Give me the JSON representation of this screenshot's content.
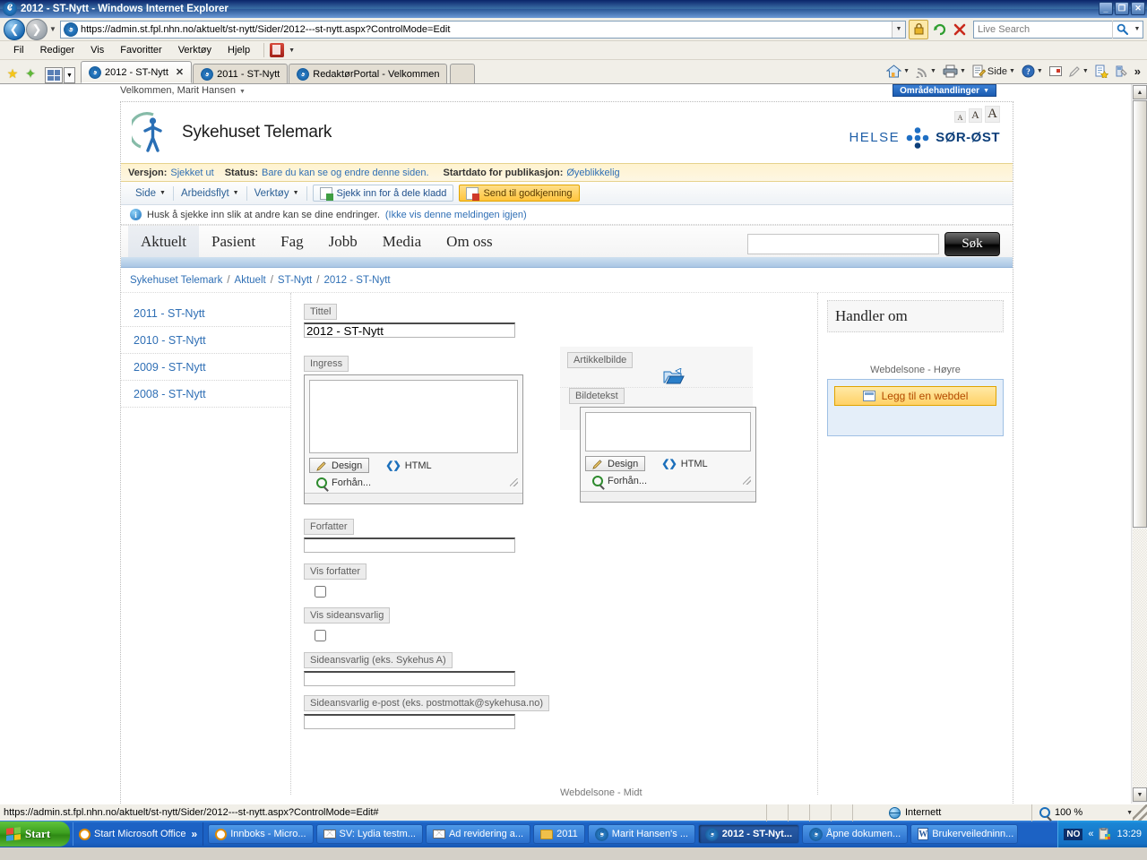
{
  "window": {
    "title": "2012 - ST-Nytt - Windows Internet Explorer",
    "minimize": "_",
    "restore": "❐",
    "close": "✕"
  },
  "browser": {
    "url": "https://admin.st.fpl.nhn.no/aktuelt/st-nytt/Sider/2012---st-nytt.aspx?ControlMode=Edit",
    "search_placeholder": "Live Search",
    "menu": [
      "Fil",
      "Rediger",
      "Vis",
      "Favoritter",
      "Verktøy",
      "Hjelp"
    ],
    "tabs": [
      {
        "label": "2012 - ST-Nytt",
        "active": true
      },
      {
        "label": "2011 - ST-Nytt",
        "active": false
      },
      {
        "label": "RedaktørPortal - Velkommen",
        "active": false
      }
    ],
    "command_bar": {
      "page_label": "Side"
    }
  },
  "sharepoint": {
    "welcome": "Velkommen, Marit Hansen",
    "site_actions": "Områdehandlinger",
    "status": {
      "version_label": "Versjon:",
      "version_value": "Sjekket ut",
      "status_label": "Status:",
      "status_value": "Bare du kan se og endre denne siden.",
      "startdate_label": "Startdato for publikasjon:",
      "startdate_value": "Øyeblikkelig"
    },
    "ribbon": {
      "menus": [
        "Side",
        "Arbeidsflyt",
        "Verktøy"
      ],
      "checkin_button": "Sjekk inn for å dele kladd",
      "approve_button": "Send til godkjenning"
    },
    "info_bar": {
      "message": "Husk å sjekke inn slik at andre kan se dine endringer.",
      "link": "(Ikke vis denne meldingen igjen)"
    }
  },
  "site": {
    "logo_text": "Sykehuset Telemark",
    "helse_word1": "HELSE",
    "helse_word2": "SØR-ØST",
    "font_sizes": [
      "A",
      "A",
      "A"
    ],
    "nav": [
      {
        "label": "Aktuelt",
        "active": true
      },
      {
        "label": "Pasient",
        "active": false
      },
      {
        "label": "Fag",
        "active": false
      },
      {
        "label": "Jobb",
        "active": false
      },
      {
        "label": "Media",
        "active": false
      },
      {
        "label": "Om oss",
        "active": false
      }
    ],
    "search_value": "",
    "search_button": "Søk",
    "breadcrumb": [
      "Sykehuset Telemark",
      "Aktuelt",
      "ST-Nytt",
      "2012 - ST-Nytt"
    ],
    "breadcrumb_sep": "/",
    "left_nav": [
      "2011 - ST-Nytt",
      "2010 - ST-Nytt",
      "2009 - ST-Nytt",
      "2008 - ST-Nytt"
    ]
  },
  "form": {
    "tittel": {
      "label": "Tittel",
      "value": "2012 - ST-Nytt"
    },
    "ingress": {
      "label": "Ingress",
      "value": ""
    },
    "artikkelbilde": {
      "label": "Artikkelbilde"
    },
    "bildetekst": {
      "label": "Bildetekst",
      "value": ""
    },
    "forfatter": {
      "label": "Forfatter",
      "value": ""
    },
    "vis_forfatter": {
      "label": "Vis forfatter",
      "checked": false
    },
    "vis_sideansvarlig": {
      "label": "Vis sideansvarlig",
      "checked": false
    },
    "sideansvarlig": {
      "label": "Sideansvarlig (eks. Sykehus A)",
      "value": ""
    },
    "sideansvarlig_epost": {
      "label": "Sideansvarlig e-post (eks. postmottak@sykehusa.no)",
      "value": ""
    },
    "rte_toolbar": {
      "design": "Design",
      "html": "HTML",
      "preview": "Forhån..."
    },
    "midt_zone": "Webdelsone - Midt"
  },
  "right_column": {
    "handler_om": "Handler om",
    "webzone_label": "Webdelsone - Høyre",
    "add_webpart": "Legg til en webdel"
  },
  "status_bar": {
    "url": "https://admin.st.fpl.nhn.no/aktuelt/st-nytt/Sider/2012---st-nytt.aspx?ControlMode=Edit#",
    "zone": "Internett",
    "zoom": "100 %"
  },
  "taskbar": {
    "start": "Start",
    "quick_launch": "Start Microsoft Office",
    "quick_more": "»",
    "tasks": [
      {
        "label": "Innboks - Micro...",
        "icon": "clock-icon",
        "active": false
      },
      {
        "label": "SV: Lydia testm...",
        "icon": "mail-icon",
        "active": false
      },
      {
        "label": "Ad revidering a...",
        "icon": "mail-icon",
        "active": false
      },
      {
        "label": "2011",
        "icon": "folder-icon",
        "active": false
      },
      {
        "label": "Marit Hansen's ...",
        "icon": "ie-icon",
        "active": false
      },
      {
        "label": "2012 - ST-Nyt...",
        "icon": "ie-icon",
        "active": true
      },
      {
        "label": "Åpne dokumen...",
        "icon": "ie-icon",
        "active": false
      },
      {
        "label": "Brukerveiledninn...",
        "icon": "word-icon",
        "active": false
      }
    ],
    "tray": {
      "lang": "NO",
      "chevron": "«",
      "clock": "13:29"
    }
  },
  "colors": {
    "accent_blue": "#1b5bb0",
    "brand_teal": "#7fb8a6",
    "brand_blue": "#2a6fb5",
    "helse_blue": "#1f5fa8",
    "link": "#2f6fb5",
    "warn_yellow": "#ffc43d"
  }
}
